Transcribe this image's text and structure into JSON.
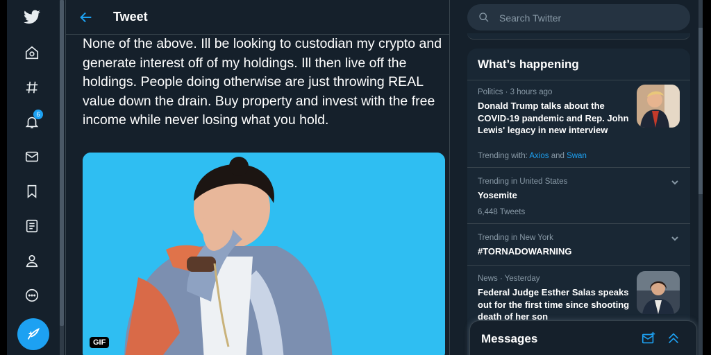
{
  "nav": {
    "items": [
      {
        "icon": "twitter-logo-icon"
      },
      {
        "icon": "home-icon"
      },
      {
        "icon": "explore-hashtag-icon"
      },
      {
        "icon": "notifications-bell-icon",
        "badge": "6"
      },
      {
        "icon": "messages-envelope-icon"
      },
      {
        "icon": "bookmarks-icon"
      },
      {
        "icon": "lists-icon"
      },
      {
        "icon": "profile-icon"
      },
      {
        "icon": "more-icon"
      }
    ],
    "compose_icon": "compose-tweet-icon"
  },
  "header": {
    "title": "Tweet"
  },
  "tweet": {
    "text": "None of the above. Ill be looking to custodian my crypto and generate interest off of my holdings. Ill then live off the holdings. People doing otherwise are just throwing REAL value down the drain. Buy property and invest with the free income while never losing what you hold.",
    "media_badge": "GIF"
  },
  "search": {
    "placeholder": "Search Twitter"
  },
  "happening": {
    "title": "What’s happening",
    "items": [
      {
        "meta": "Politics · 3 hours ago",
        "headline": "Donald Trump talks about the COVID-19 pandemic and Rep. John Lewis' legacy in new interview",
        "trending_prefix": "Trending with: ",
        "link1": "Axios",
        "and": " and ",
        "link2": "Swan"
      },
      {
        "meta": "Trending in United States",
        "headline": "Yosemite",
        "sub": "6,448 Tweets"
      },
      {
        "meta": "Trending in New York",
        "headline": "#TORNADOWARNING"
      },
      {
        "meta": "News · Yesterday",
        "headline": "Federal Judge Esther Salas speaks out for the first time since shooting death of her son"
      }
    ]
  },
  "messages": {
    "title": "Messages"
  },
  "colors": {
    "accent": "#1da1f2",
    "background": "#15202b",
    "panel": "#192734",
    "media_bg": "#2fbef2"
  }
}
